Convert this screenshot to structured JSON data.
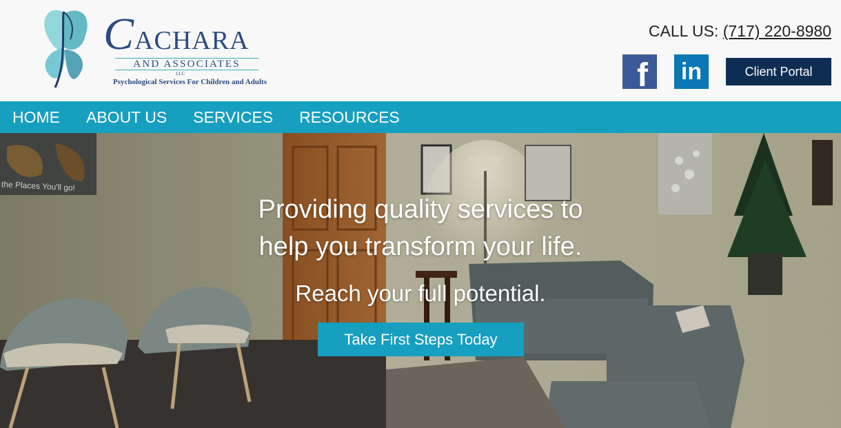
{
  "brand": {
    "name_initial": "C",
    "name_rest": "ACHARA",
    "associates": "AND ASSOCIATES",
    "llc": "LLC",
    "tagline": "Psychological Services For Children and Adults"
  },
  "contact": {
    "call_label": "CALL US:",
    "phone": "(717) 220-8980"
  },
  "social": {
    "facebook_glyph": "f",
    "linkedin_glyph": "in"
  },
  "header": {
    "client_portal_label": "Client Portal"
  },
  "nav": {
    "items": [
      {
        "label": "HOME"
      },
      {
        "label": "ABOUT US"
      },
      {
        "label": "SERVICES"
      },
      {
        "label": "RESOURCES"
      }
    ]
  },
  "hero": {
    "title_line1": "Providing quality services to",
    "title_line2": "help you transform your life.",
    "subtitle": "Reach your full potential.",
    "cta_label": "Take First Steps Today",
    "map_caption": "the Places You'll go!"
  },
  "colors": {
    "nav_bg": "#169fbf",
    "portal_bg": "#0d2d52",
    "brand_navy": "#2b4a7e",
    "brand_teal": "#3fa9b8"
  }
}
